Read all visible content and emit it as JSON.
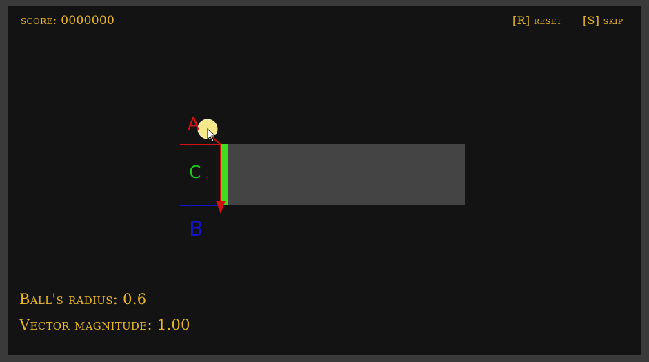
{
  "hud": {
    "score": "score: 0000000",
    "reset_hint": "[R] reset",
    "skip_hint": "[S] skip",
    "ball_radius": "Ball's radius: 0.6",
    "vector_magnitude": "Vector magnitude: 1.00"
  },
  "scene": {
    "label_a": "A",
    "label_b": "B",
    "label_c": "C"
  },
  "colors": {
    "hud_text": "#e8b72a",
    "background": "#131313",
    "frame": "#3a3a3a",
    "platform": "#444444",
    "edge_highlight": "#3fdd1c",
    "line_a": "#d41212",
    "line_b": "#1414c8",
    "label_c": "#1cc41c",
    "ball": "#f6e98a"
  },
  "icons": {
    "cursor": "pointer-cursor-icon",
    "arrow": "down-arrow-icon"
  }
}
